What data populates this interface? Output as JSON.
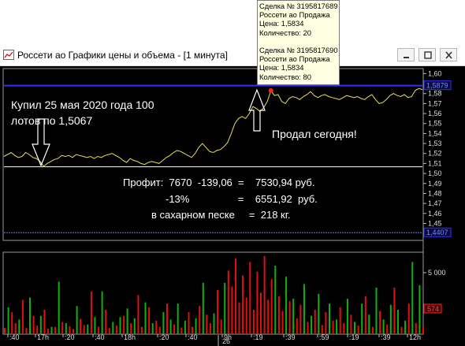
{
  "window": {
    "title": "Россети ао Графики цены и объема - [1 минута]"
  },
  "tooltip": {
    "deal1": {
      "title": "Сделка № 3195817689",
      "line1": "Россети ао Продажа",
      "line2": "Цена: 1,5834",
      "line3": "Количество: 20"
    },
    "deal2": {
      "title": "Сделка № 3195817690",
      "line1": "Россети ао Продажа",
      "line2": "Цена: 1,5834",
      "line3": "Количество: 80"
    }
  },
  "annotations": {
    "buy_line1": "Купил 25 мая 2020 года 100",
    "buy_line2": "лотов по 1,5067",
    "sold": "Продал сегодня!",
    "profit_line1": "Профит:  7670  -139,06  =    7530,94 руб.",
    "profit_line2": "-13%                 =    6551,92  руб.",
    "profit_line3": "в сахарном песке     =  218 кг."
  },
  "colors": {
    "background": "#000000",
    "price_line": "#e8e05a",
    "current_price_line": "#3030ff",
    "low_line": "#7070ff",
    "volume_red": "#e01010",
    "volume_green": "#10b010",
    "text": "#ffffff",
    "tooltip_bg": "#ffffe1"
  },
  "chart_data": [
    {
      "type": "line",
      "series": [
        {
          "values": [
            1.517,
            1.519,
            1.521,
            1.518,
            1.516,
            1.517,
            1.521,
            1.519,
            1.516,
            1.515,
            1.512,
            1.507,
            1.51,
            1.512,
            1.514,
            1.515,
            1.518,
            1.517,
            1.518,
            1.516,
            1.519,
            1.518,
            1.517,
            1.516,
            1.517,
            1.515,
            1.517,
            1.516,
            1.518,
            1.519,
            1.52,
            1.518,
            1.516,
            1.513,
            1.511,
            1.515,
            1.513,
            1.512,
            1.51,
            1.509,
            1.511,
            1.512,
            1.511,
            1.51,
            1.513,
            1.516,
            1.518,
            1.521,
            1.523,
            1.522,
            1.52,
            1.518,
            1.516,
            1.52,
            1.526,
            1.53,
            1.526,
            1.522,
            1.521,
            1.523,
            1.524,
            1.527,
            1.531,
            1.54,
            1.55,
            1.555,
            1.557,
            1.555,
            1.56,
            1.567,
            1.565,
            1.562,
            1.566,
            1.572,
            1.583,
            1.578,
            1.579,
            1.572,
            1.57,
            1.575,
            1.577,
            1.576,
            1.574,
            1.577,
            1.579,
            1.582,
            1.578,
            1.576,
            1.578,
            1.579,
            1.577,
            1.576,
            1.575,
            1.574,
            1.576,
            1.578,
            1.577,
            1.576,
            1.577,
            1.575,
            1.574,
            1.577,
            1.579,
            1.574,
            1.57,
            1.571,
            1.574,
            1.578,
            1.58,
            1.578,
            1.577,
            1.579,
            1.576,
            1.577,
            1.583,
            1.585,
            1.584
          ]
        }
      ],
      "yticks": [
        "1,60",
        "1,59",
        "1,58",
        "1,57",
        "1,56",
        "1,55",
        "1,54",
        "1,53",
        "1,52",
        "1,51",
        "1,50",
        "1,49",
        "1,48",
        "1,47",
        "1,46",
        "1,45",
        "1,44"
      ],
      "ylim": [
        1.433,
        1.605
      ],
      "current_price": 1.5879,
      "current_price_label": "1,5879",
      "low_price": 1.4407,
      "low_price_label": "1,4407",
      "buy_price": 1.5067,
      "grid": false
    },
    {
      "type": "bar",
      "yticks": [
        "5 000"
      ],
      "ylim": [
        0,
        6700
      ],
      "last_value_label": "574",
      "xticks": [
        ":40",
        "17h",
        ":20",
        ":40",
        "18h",
        ":20",
        ":40",
        "9h",
        ":19",
        ":39",
        ":59",
        ":19",
        ":39",
        "12h"
      ],
      "date_label": "26",
      "series": [
        {
          "name": "",
          "color": "#e01010",
          "values": [
            {
              "i": 0,
              "v": 520
            },
            {
              "i": 2,
              "v": 1800
            },
            {
              "i": 3,
              "v": 900
            },
            {
              "i": 5,
              "v": 2800
            },
            {
              "i": 6,
              "v": 500
            },
            {
              "i": 8,
              "v": 1500
            },
            {
              "i": 9,
              "v": 700
            },
            {
              "i": 11,
              "v": 2000
            },
            {
              "i": 12,
              "v": 450
            },
            {
              "i": 14,
              "v": 600
            },
            {
              "i": 16,
              "v": 1000
            },
            {
              "i": 18,
              "v": 650
            },
            {
              "i": 19,
              "v": 420
            },
            {
              "i": 21,
              "v": 1250
            },
            {
              "i": 22,
              "v": 750
            },
            {
              "i": 24,
              "v": 3500
            },
            {
              "i": 26,
              "v": 600
            },
            {
              "i": 28,
              "v": 2000
            },
            {
              "i": 29,
              "v": 500
            },
            {
              "i": 31,
              "v": 700
            },
            {
              "i": 33,
              "v": 1500
            },
            {
              "i": 35,
              "v": 900
            },
            {
              "i": 37,
              "v": 3200
            },
            {
              "i": 38,
              "v": 600
            },
            {
              "i": 40,
              "v": 2200
            },
            {
              "i": 42,
              "v": 1100
            },
            {
              "i": 43,
              "v": 600
            },
            {
              "i": 45,
              "v": 2500
            },
            {
              "i": 47,
              "v": 800
            },
            {
              "i": 49,
              "v": 550
            },
            {
              "i": 51,
              "v": 1800
            },
            {
              "i": 52,
              "v": 600
            },
            {
              "i": 54,
              "v": 2300
            },
            {
              "i": 56,
              "v": 1600
            },
            {
              "i": 57,
              "v": 900
            },
            {
              "i": 59,
              "v": 3600
            },
            {
              "i": 60,
              "v": 1200
            },
            {
              "i": 62,
              "v": 5200
            },
            {
              "i": 63,
              "v": 3900
            },
            {
              "i": 64,
              "v": 6200
            },
            {
              "i": 65,
              "v": 2600
            },
            {
              "i": 66,
              "v": 4800
            },
            {
              "i": 67,
              "v": 3000
            },
            {
              "i": 68,
              "v": 5900
            },
            {
              "i": 69,
              "v": 2000
            },
            {
              "i": 70,
              "v": 5100
            },
            {
              "i": 71,
              "v": 3400
            },
            {
              "i": 72,
              "v": 6400
            },
            {
              "i": 73,
              "v": 2800
            },
            {
              "i": 74,
              "v": 4500
            },
            {
              "i": 76,
              "v": 3100
            },
            {
              "i": 77,
              "v": 1900
            },
            {
              "i": 79,
              "v": 2700
            },
            {
              "i": 81,
              "v": 1300
            },
            {
              "i": 82,
              "v": 2400
            },
            {
              "i": 84,
              "v": 1000
            },
            {
              "i": 86,
              "v": 2000
            },
            {
              "i": 88,
              "v": 750
            },
            {
              "i": 89,
              "v": 1800
            },
            {
              "i": 91,
              "v": 1100
            },
            {
              "i": 93,
              "v": 2200
            },
            {
              "i": 94,
              "v": 900
            },
            {
              "i": 96,
              "v": 1600
            },
            {
              "i": 98,
              "v": 700
            },
            {
              "i": 100,
              "v": 3100
            },
            {
              "i": 102,
              "v": 600
            },
            {
              "i": 104,
              "v": 1900
            },
            {
              "i": 106,
              "v": 800
            },
            {
              "i": 108,
              "v": 3800
            },
            {
              "i": 110,
              "v": 600
            },
            {
              "i": 112,
              "v": 2500
            },
            {
              "i": 114,
              "v": 900
            },
            {
              "i": 116,
              "v": 574
            }
          ]
        },
        {
          "name": "",
          "color": "#10b010",
          "values": [
            {
              "i": 1,
              "v": 2200
            },
            {
              "i": 4,
              "v": 1200
            },
            {
              "i": 7,
              "v": 3000
            },
            {
              "i": 10,
              "v": 1500
            },
            {
              "i": 13,
              "v": 600
            },
            {
              "i": 15,
              "v": 4300
            },
            {
              "i": 17,
              "v": 900
            },
            {
              "i": 20,
              "v": 2300
            },
            {
              "i": 23,
              "v": 800
            },
            {
              "i": 25,
              "v": 1400
            },
            {
              "i": 27,
              "v": 3500
            },
            {
              "i": 30,
              "v": 1000
            },
            {
              "i": 32,
              "v": 1400
            },
            {
              "i": 34,
              "v": 2100
            },
            {
              "i": 36,
              "v": 1300
            },
            {
              "i": 39,
              "v": 2600
            },
            {
              "i": 41,
              "v": 900
            },
            {
              "i": 44,
              "v": 1800
            },
            {
              "i": 46,
              "v": 1200
            },
            {
              "i": 48,
              "v": 2500
            },
            {
              "i": 50,
              "v": 1100
            },
            {
              "i": 53,
              "v": 1300
            },
            {
              "i": 55,
              "v": 4200
            },
            {
              "i": 58,
              "v": 1700
            },
            {
              "i": 61,
              "v": 4200
            },
            {
              "i": 75,
              "v": 5600
            },
            {
              "i": 78,
              "v": 4700
            },
            {
              "i": 80,
              "v": 2900
            },
            {
              "i": 83,
              "v": 4100
            },
            {
              "i": 85,
              "v": 1500
            },
            {
              "i": 87,
              "v": 3300
            },
            {
              "i": 90,
              "v": 2500
            },
            {
              "i": 92,
              "v": 1200
            },
            {
              "i": 95,
              "v": 2900
            },
            {
              "i": 97,
              "v": 1000
            },
            {
              "i": 99,
              "v": 2500
            },
            {
              "i": 101,
              "v": 1600
            },
            {
              "i": 103,
              "v": 3800
            },
            {
              "i": 105,
              "v": 1200
            },
            {
              "i": 107,
              "v": 2400
            },
            {
              "i": 109,
              "v": 2000
            },
            {
              "i": 111,
              "v": 1100
            },
            {
              "i": 113,
              "v": 5900
            },
            {
              "i": 115,
              "v": 4000
            }
          ]
        }
      ]
    }
  ]
}
